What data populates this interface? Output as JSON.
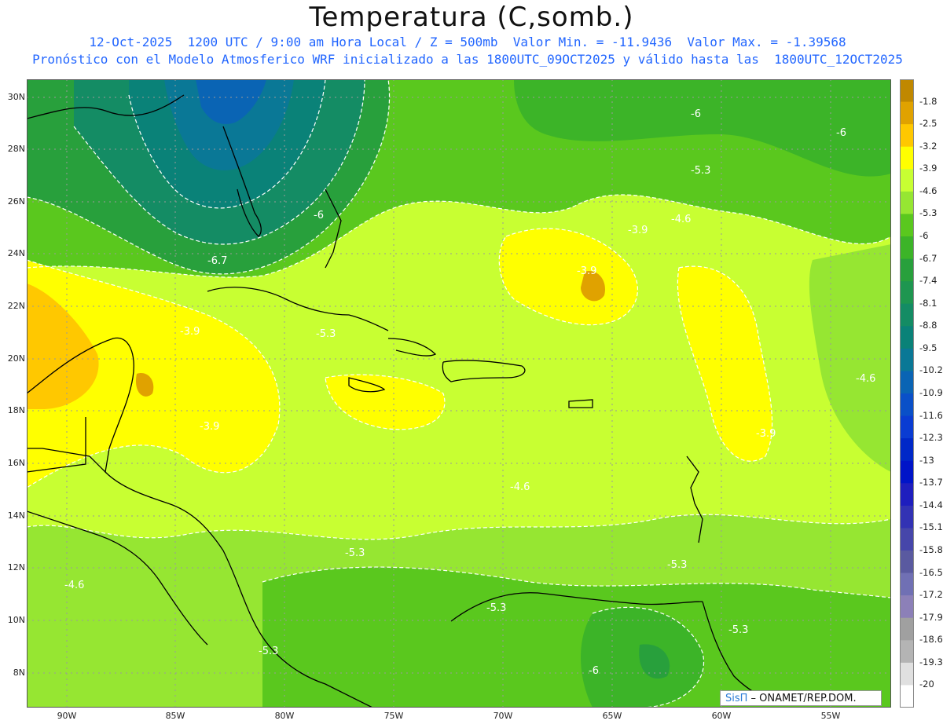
{
  "header": {
    "title": "Temperatura (C,somb.)",
    "line1": "12-Oct-2025  1200 UTC / 9:00 am Hora Local / Z = 500mb  Valor Min. = -11.9436  Valor Max. = -1.39568",
    "line2": "Pronóstico con el Modelo Atmosferico WRF inicializado a las 1800UTC_09OCT2025 y válido hasta las  1800UTC_12OCT2025"
  },
  "axes": {
    "lat_labels": [
      "30N",
      "28N",
      "26N",
      "24N",
      "22N",
      "20N",
      "18N",
      "16N",
      "14N",
      "12N",
      "10N",
      "8N"
    ],
    "lon_labels": [
      "90W",
      "85W",
      "80W",
      "75W",
      "70W",
      "65W",
      "60W",
      "55W"
    ]
  },
  "colorbar": {
    "labels": [
      "-1.8",
      "-2.5",
      "-3.2",
      "-3.9",
      "-4.6",
      "-5.3",
      "-6",
      "-6.7",
      "-7.4",
      "-8.1",
      "-8.8",
      "-9.5",
      "-10.2",
      "-10.9",
      "-11.6",
      "-12.3",
      "-13",
      "-13.7",
      "-14.4",
      "-15.1",
      "-15.8",
      "-16.5",
      "-17.2",
      "-17.9",
      "-18.6",
      "-19.3",
      "-20"
    ],
    "colors": [
      "#c08800",
      "#e0a200",
      "#ffc800",
      "#ffff00",
      "#c8ff32",
      "#96e632",
      "#5ac81e",
      "#3cb428",
      "#28a03c",
      "#1e9650",
      "#148c64",
      "#0a8278",
      "#0a7896",
      "#0a64b4",
      "#0a50c8",
      "#0a3cd2",
      "#0028c8",
      "#0014c8",
      "#1e1ebe",
      "#3232b4",
      "#4646aa",
      "#5a5aa0",
      "#7070b4",
      "#8c80b8",
      "#a0a0a0",
      "#b4b4b4",
      "#e0e0e0",
      "#ffffff"
    ]
  },
  "contour_labels": [
    "-6",
    "-6",
    "-5.3",
    "-6",
    "-4.6",
    "-3.9",
    "-6.7",
    "-3.9",
    "-3.9",
    "-5.3",
    "-3.9",
    "-3.9",
    "-4.6",
    "-4.6",
    "-5.3",
    "-5.3",
    "-4.6",
    "-5.3",
    "-5.3",
    "-5.3",
    "-6"
  ],
  "credit": {
    "brand": "SisΠ",
    "text": " – ONAMET/REP.DOM."
  }
}
